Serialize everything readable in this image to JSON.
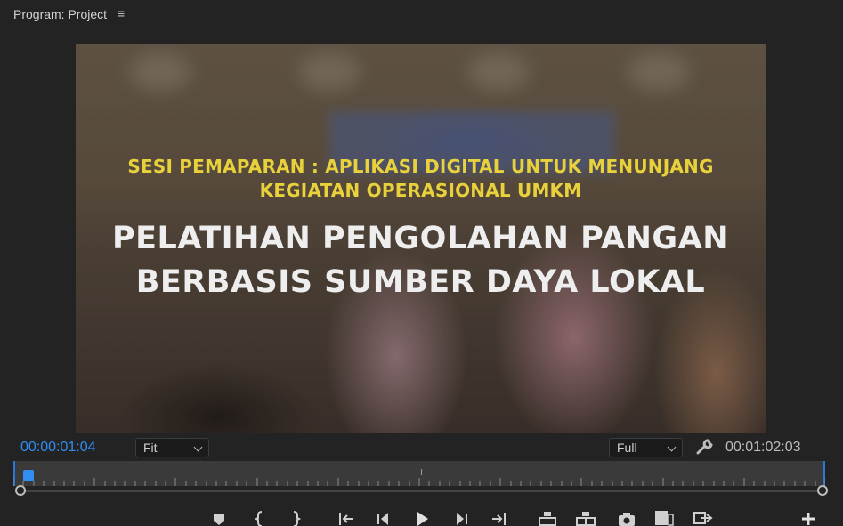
{
  "panel": {
    "title": "Program: Project",
    "menu_glyph": "≡"
  },
  "video": {
    "subtitle_line1": "SESI PEMAPARAN : APLIKASI DIGITAL UNTUK MENUNJANG",
    "subtitle_line2": "KEGIATAN OPERASIONAL UMKM",
    "title_line1": "PELATIHAN PENGOLAHAN PANGAN",
    "title_line2": "BERBASIS SUMBER DAYA LOKAL",
    "subtitle_color": "#e8d13a",
    "title_color": "#eeeeee"
  },
  "transport": {
    "current_timecode": "00:00:01:04",
    "duration_timecode": "00:01:02:03",
    "zoom_value": "Fit",
    "resolution_value": "Full",
    "settings_icon": "wrench-icon",
    "playhead_position": 0.012,
    "accent_color": "#2f8ef0"
  },
  "controls": [
    "add-marker-icon",
    "mark-in-icon",
    "mark-out-icon",
    "go-to-in-icon",
    "step-back-icon",
    "play-icon",
    "step-forward-icon",
    "go-to-out-icon",
    "lift-icon",
    "extract-icon",
    "export-frame-icon",
    "insert-icon",
    "overwrite-icon",
    "button-editor-icon"
  ]
}
